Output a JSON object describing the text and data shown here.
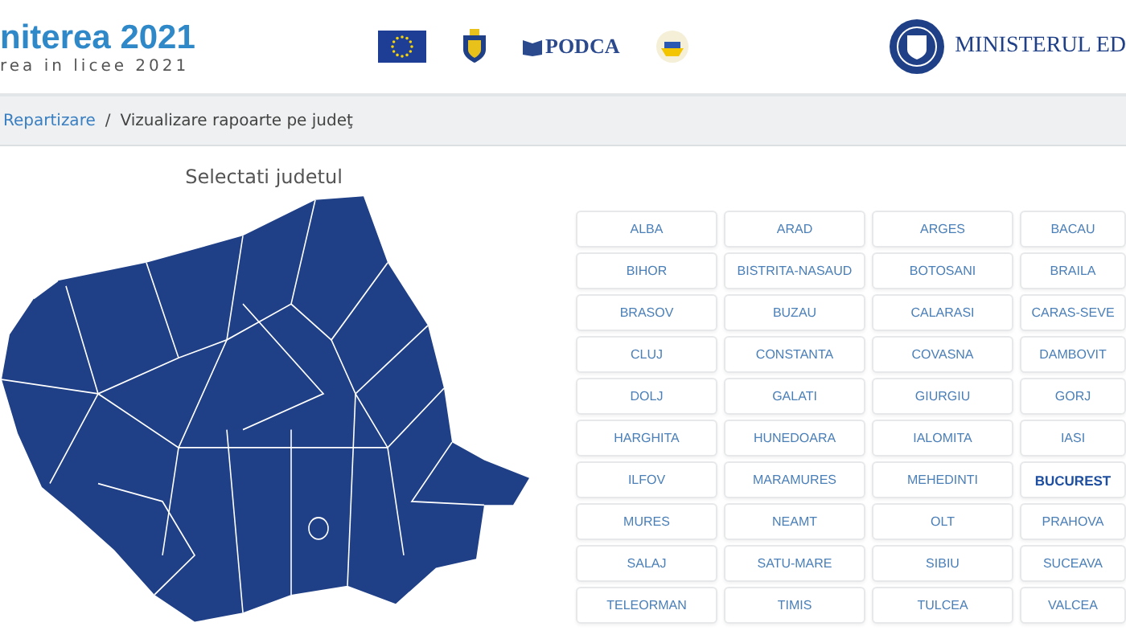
{
  "header": {
    "title": "niterea 2021",
    "subtitle": "rea in licee 2021",
    "partner": "PODCA",
    "ministry": "MINISTERUL ED"
  },
  "breadcrumb": {
    "link": "Repartizare",
    "separator": "/",
    "current": "Vizualizare rapoarte pe judeţ"
  },
  "map": {
    "title": "Selectati judetul"
  },
  "counties": [
    {
      "label": "ALBA",
      "selected": false
    },
    {
      "label": "ARAD",
      "selected": false
    },
    {
      "label": "ARGES",
      "selected": false
    },
    {
      "label": "BACAU",
      "selected": false
    },
    {
      "label": "BIHOR",
      "selected": false
    },
    {
      "label": "BISTRITA-NASAUD",
      "selected": false
    },
    {
      "label": "BOTOSANI",
      "selected": false
    },
    {
      "label": "BRAILA",
      "selected": false
    },
    {
      "label": "BRASOV",
      "selected": false
    },
    {
      "label": "BUZAU",
      "selected": false
    },
    {
      "label": "CALARASI",
      "selected": false
    },
    {
      "label": "CARAS-SEVE",
      "selected": false
    },
    {
      "label": "CLUJ",
      "selected": false
    },
    {
      "label": "CONSTANTA",
      "selected": false
    },
    {
      "label": "COVASNA",
      "selected": false
    },
    {
      "label": "DAMBOVIT",
      "selected": false
    },
    {
      "label": "DOLJ",
      "selected": false
    },
    {
      "label": "GALATI",
      "selected": false
    },
    {
      "label": "GIURGIU",
      "selected": false
    },
    {
      "label": "GORJ",
      "selected": false
    },
    {
      "label": "HARGHITA",
      "selected": false
    },
    {
      "label": "HUNEDOARA",
      "selected": false
    },
    {
      "label": "IALOMITA",
      "selected": false
    },
    {
      "label": "IASI",
      "selected": false
    },
    {
      "label": "ILFOV",
      "selected": false
    },
    {
      "label": "MARAMURES",
      "selected": false
    },
    {
      "label": "MEHEDINTI",
      "selected": false
    },
    {
      "label": "BUCUREST",
      "selected": true
    },
    {
      "label": "MURES",
      "selected": false
    },
    {
      "label": "NEAMT",
      "selected": false
    },
    {
      "label": "OLT",
      "selected": false
    },
    {
      "label": "PRAHOVA",
      "selected": false
    },
    {
      "label": "SALAJ",
      "selected": false
    },
    {
      "label": "SATU-MARE",
      "selected": false
    },
    {
      "label": "SIBIU",
      "selected": false
    },
    {
      "label": "SUCEAVA",
      "selected": false
    },
    {
      "label": "TELEORMAN",
      "selected": false
    },
    {
      "label": "TIMIS",
      "selected": false
    },
    {
      "label": "TULCEA",
      "selected": false
    },
    {
      "label": "VALCEA",
      "selected": false
    }
  ]
}
